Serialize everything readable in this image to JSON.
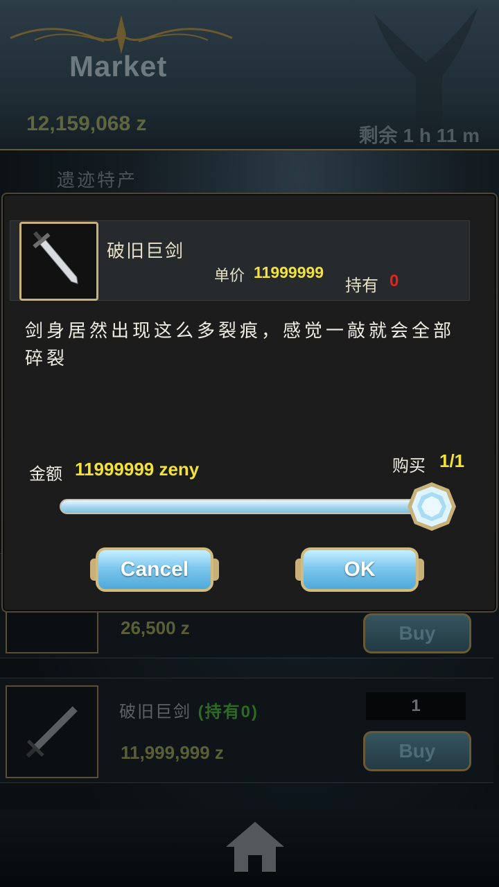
{
  "market": {
    "title": "Market",
    "zeny_total": "12,159,068 z",
    "remaining": "剩余 1 h 11 m",
    "section_label": "遗迹特产"
  },
  "list": {
    "row1": {
      "price": "26,500 z",
      "buy_label": "Buy"
    },
    "row2": {
      "name": "破旧巨剑",
      "owned": "(持有0)",
      "price": "11,999,999 z",
      "quantity": "1",
      "buy_label": "Buy"
    }
  },
  "dialog": {
    "item_name": "破旧巨剑",
    "unit_price_label": "单价",
    "unit_price_value": "11999999",
    "owned_label": "持有",
    "owned_value": "0",
    "description": "剑身居然出现这么多裂痕，感觉一敲就会全部碎裂",
    "amount_label": "金额",
    "amount_value": "11999999 zeny",
    "buy_count_label": "购买",
    "buy_count_value": "1/1",
    "slider_fraction": 1.0,
    "cancel_label": "Cancel",
    "ok_label": "OK"
  },
  "icons": {
    "item": "sword-icon",
    "knob": "diamond-knob-icon",
    "home": "home-icon"
  },
  "colors": {
    "accent_yellow": "#f2e23a",
    "owned_red": "#e3261c",
    "frame_gold": "#c9b37a",
    "button_blue": "#7ec8ee"
  }
}
